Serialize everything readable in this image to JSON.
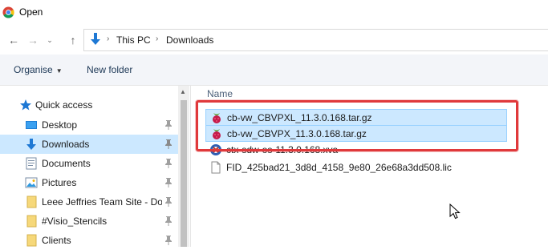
{
  "window": {
    "title": "Open"
  },
  "nav": {
    "back_glyph": "←",
    "forward_glyph": "→",
    "recent_glyph": "⌄",
    "up_glyph": "↑",
    "breadcrumb": [
      "This PC",
      "Downloads"
    ],
    "separator": "›"
  },
  "toolbar": {
    "organise_label": "Organise",
    "new_folder_label": "New folder",
    "caret": "▼"
  },
  "sidebar": {
    "quick_access_label": "Quick access",
    "items": [
      {
        "label": "Desktop",
        "icon": "desktop-icon",
        "pinned": true
      },
      {
        "label": "Downloads",
        "icon": "download-arrow-icon",
        "pinned": true,
        "selected": true
      },
      {
        "label": "Documents",
        "icon": "documents-icon",
        "pinned": true
      },
      {
        "label": "Pictures",
        "icon": "pictures-icon",
        "pinned": true
      },
      {
        "label": "Leee Jeffries Team Site - Docu",
        "icon": "folder-icon",
        "pinned": true
      },
      {
        "label": "#Visio_Stencils",
        "icon": "folder-icon",
        "pinned": true
      },
      {
        "label": "Clients",
        "icon": "folder-icon",
        "pinned": true
      }
    ]
  },
  "content": {
    "column_name": "Name",
    "files": [
      {
        "name": "cb-vw_CBVPXL_11.3.0.168.tar.gz",
        "icon": "raspberry-archive-icon",
        "selected": true
      },
      {
        "name": "cb-vw_CBVPX_11.3.0.168.tar.gz",
        "icon": "raspberry-archive-icon",
        "selected": true
      },
      {
        "name": "ctx-sdw-os-11.3.0.168.xva",
        "icon": "xva-file-icon",
        "selected": false
      },
      {
        "name": "FID_425bad21_3d8d_4158_9e80_26e68a3dd508.lic",
        "icon": "generic-file-icon",
        "selected": false
      }
    ]
  },
  "colors": {
    "selection_bg": "#cce8ff",
    "highlight_border": "#e0393b",
    "toolbar_bg": "#f3f5f9",
    "accent_blue": "#1e78d4"
  }
}
